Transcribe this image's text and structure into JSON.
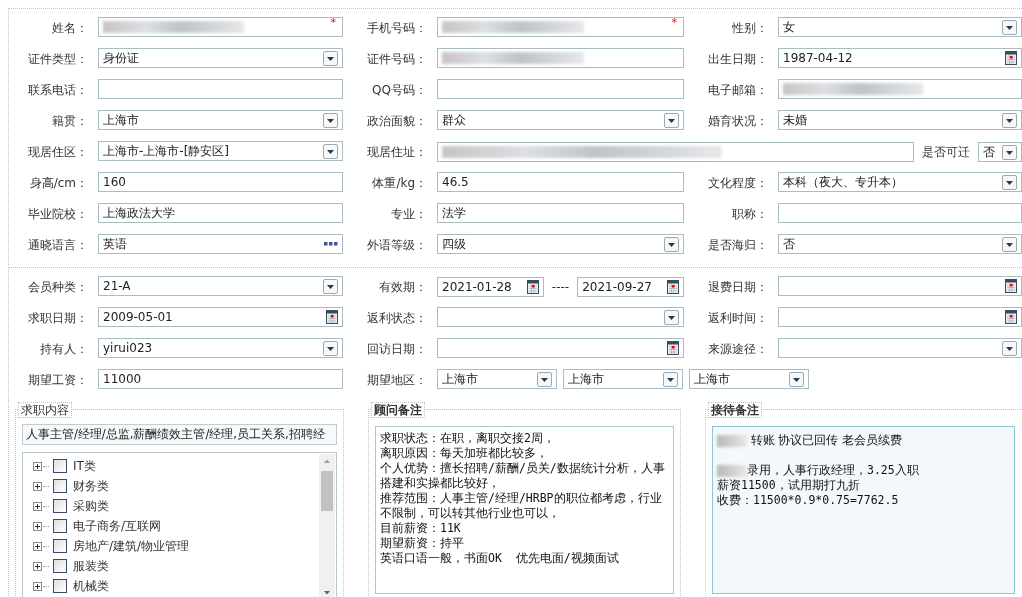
{
  "sections": [
    {
      "rows": [
        {
          "cells": [
            {
              "label": "姓名：",
              "controls": [
                {
                  "kind": "text",
                  "redacted": true,
                  "required_mark": "*"
                }
              ]
            },
            {
              "label": "手机号码：",
              "controls": [
                {
                  "kind": "text",
                  "redacted": true,
                  "required_mark": "*"
                }
              ]
            },
            {
              "label": "性别：",
              "controls": [
                {
                  "kind": "select",
                  "value": "女",
                  "redacted": false
                }
              ]
            }
          ]
        },
        {
          "cells": [
            {
              "label": "证件类型：",
              "controls": [
                {
                  "kind": "select",
                  "value": "身份证",
                  "redacted": false
                }
              ]
            },
            {
              "label": "证件号码：",
              "controls": [
                {
                  "kind": "text",
                  "redacted": true
                }
              ]
            },
            {
              "label": "出生日期：",
              "controls": [
                {
                  "kind": "date",
                  "value": "1987-04-12",
                  "redacted": false
                }
              ]
            }
          ]
        },
        {
          "cells": [
            {
              "label": "联系电话：",
              "controls": [
                {
                  "kind": "text",
                  "redacted": false
                }
              ]
            },
            {
              "label": "QQ号码：",
              "controls": [
                {
                  "kind": "text",
                  "redacted": false
                }
              ]
            },
            {
              "label": "电子邮箱：",
              "controls": [
                {
                  "kind": "text",
                  "redacted": true
                }
              ]
            }
          ]
        },
        {
          "cells": [
            {
              "label": "籍贯：",
              "controls": [
                {
                  "kind": "select",
                  "value": "上海市",
                  "redacted": false
                }
              ]
            },
            {
              "label": "政治面貌：",
              "controls": [
                {
                  "kind": "select",
                  "value": "群众",
                  "redacted": false
                }
              ]
            },
            {
              "label": "婚育状况：",
              "controls": [
                {
                  "kind": "select",
                  "value": "未婚",
                  "redacted": false
                }
              ]
            }
          ]
        },
        {
          "cells": [
            {
              "label": "现居住区：",
              "controls": [
                {
                  "kind": "select",
                  "value": " 上海市-上海市-[静安区]",
                  "redacted": false
                }
              ]
            },
            {
              "label": "现居住址：",
              "controls": [
                {
                  "kind": "text",
                  "redacted": true
                },
                {
                  "kind": "label",
                  "text": "是否可迁"
                },
                {
                  "kind": "select",
                  "value": "否",
                  "redacted": false
                }
              ]
            }
          ]
        },
        {
          "cells": [
            {
              "label": "身高/cm：",
              "controls": [
                {
                  "kind": "text",
                  "value": "160",
                  "redacted": false
                }
              ]
            },
            {
              "label": "体重/kg：",
              "controls": [
                {
                  "kind": "text",
                  "value": "46.5",
                  "redacted": false
                }
              ]
            },
            {
              "label": "文化程度：",
              "controls": [
                {
                  "kind": "select",
                  "value": "本科（夜大、专升本）",
                  "redacted": false
                }
              ]
            }
          ]
        },
        {
          "cells": [
            {
              "label": "毕业院校：",
              "controls": [
                {
                  "kind": "text",
                  "value": "上海政法大学",
                  "redacted": false
                }
              ]
            },
            {
              "label": "专业：",
              "controls": [
                {
                  "kind": "text",
                  "value": "法学",
                  "redacted": false
                }
              ]
            },
            {
              "label": "职称：",
              "controls": [
                {
                  "kind": "text",
                  "redacted": false
                }
              ]
            }
          ]
        },
        {
          "cells": [
            {
              "label": "通晓语言：",
              "controls": [
                {
                  "kind": "lookup",
                  "value": "英语",
                  "redacted": false
                }
              ]
            },
            {
              "label": "外语等级：",
              "controls": [
                {
                  "kind": "select",
                  "value": "四级",
                  "redacted": false
                }
              ]
            },
            {
              "label": "是否海归：",
              "controls": [
                {
                  "kind": "select",
                  "value": "否",
                  "redacted": false
                }
              ]
            }
          ]
        }
      ]
    },
    {
      "rows": [
        {
          "cells": [
            {
              "label": "会员种类：",
              "controls": [
                {
                  "kind": "select",
                  "value": " 21-A",
                  "redacted": false
                }
              ]
            },
            {
              "label": "有效期：",
              "controls": [
                {
                  "kind": "date",
                  "value": "2021-01-28",
                  "redacted": false
                },
                {
                  "kind": "label",
                  "text": "----"
                },
                {
                  "kind": "date",
                  "value": "2021-09-27",
                  "redacted": false
                }
              ]
            },
            {
              "label": "退费日期：",
              "controls": [
                {
                  "kind": "date",
                  "redacted": false
                }
              ]
            }
          ]
        },
        {
          "cells": [
            {
              "label": "求职日期：",
              "controls": [
                {
                  "kind": "date",
                  "value": "2009-05-01",
                  "redacted": false
                }
              ]
            },
            {
              "label": "返利状态：",
              "controls": [
                {
                  "kind": "select",
                  "redacted": false
                }
              ]
            },
            {
              "label": "返利时间：",
              "controls": [
                {
                  "kind": "date",
                  "redacted": false
                }
              ]
            }
          ]
        },
        {
          "cells": [
            {
              "label": "持有人：",
              "controls": [
                {
                  "kind": "select",
                  "value": "yirui023",
                  "redacted": false
                }
              ]
            },
            {
              "label": "回访日期：",
              "controls": [
                {
                  "kind": "date",
                  "redacted": false
                }
              ]
            },
            {
              "label": "来源途径：",
              "controls": [
                {
                  "kind": "select",
                  "redacted": false
                }
              ]
            }
          ]
        },
        {
          "cells": [
            {
              "label": "期望工资：",
              "controls": [
                {
                  "kind": "text",
                  "value": "11000",
                  "redacted": false
                }
              ]
            },
            {
              "label": "期望地区：",
              "controls": [
                {
                  "kind": "select",
                  "value": " 上海市",
                  "redacted": false
                },
                {
                  "kind": "select",
                  "value": " 上海市",
                  "redacted": false
                },
                {
                  "kind": "select",
                  "value": " 上海市",
                  "redacted": false
                }
              ]
            }
          ]
        }
      ]
    }
  ],
  "job_content": {
    "legend": "求职内容",
    "summary": "人事主管/经理/总监,薪酬绩效主管/经理,员工关系,招聘经",
    "tree": [
      {
        "label": "IT类",
        "expanded": false,
        "checked": false
      },
      {
        "label": "财务类",
        "expanded": false,
        "checked": false
      },
      {
        "label": "采购类",
        "expanded": false,
        "checked": false
      },
      {
        "label": "电子商务/互联网",
        "expanded": false,
        "checked": false
      },
      {
        "label": "房地产/建筑/物业管理",
        "expanded": false,
        "checked": false
      },
      {
        "label": "服装类",
        "expanded": false,
        "checked": false
      },
      {
        "label": "机械类",
        "expanded": false,
        "checked": false
      }
    ]
  },
  "advisor_notes": {
    "legend": "顾问备注",
    "paragraphs": [
      "求职状态：在职，离职交接2周，",
      "离职原因：每天加班都比较多，",
      "个人优势：擅长招聘/薪酬/员关/数据统计分析，人事搭建和实操都比较好，",
      "推荐范围：人事主管/经理/HRBP的职位都考虑，行业不限制，可以转其他行业也可以，",
      "目前薪资：11K",
      "期望薪资：持平",
      "英语口语一般，书面OK  优先电面/视频面试"
    ]
  },
  "reception_notes": {
    "legend": "接待备注",
    "blocks": [
      [
        {
          "redacted": true,
          "text": " 转账 协议已回传 老会员续费"
        }
      ],
      [
        {
          "redacted": true,
          "text": "录用，人事行政经理，3.25入职"
        },
        {
          "redacted": false,
          "text": "薪资11500，试用期打九折"
        },
        {
          "redacted": false,
          "text": "收费：11500*0.9*0.75=7762.5"
        }
      ]
    ]
  }
}
